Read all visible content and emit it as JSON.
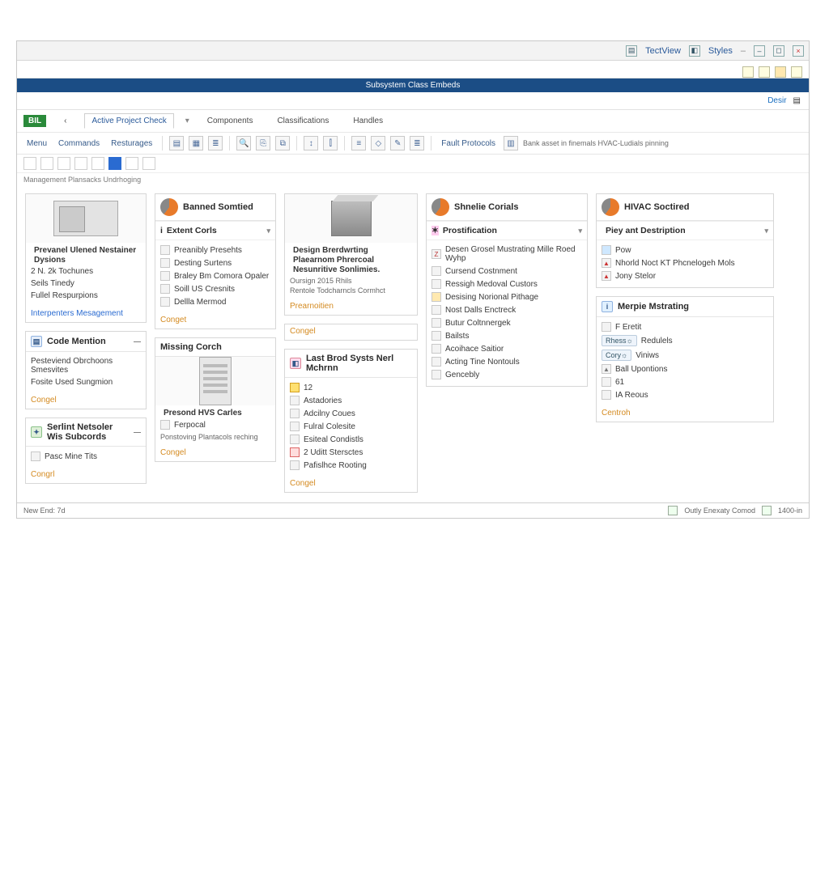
{
  "titlebar": {
    "tectview": "TectView",
    "styles": "Styles",
    "close": "×"
  },
  "subtitle": "Subsystem Class Embeds",
  "breadcrumb": {
    "label": "Desir"
  },
  "menubar": {
    "badge": "BIL",
    "back": "‹",
    "tab_active": "Active Project Check",
    "tab2": "Components",
    "tab3": "Classifications",
    "tab4": "Handles"
  },
  "toolbar": {
    "label_menu": "Menu",
    "label_commands": "Commands",
    "label_resources": "Resturages",
    "fault": "Fault Protocols",
    "hint": "Bank asset in finemals HVAC-Ludials pinning"
  },
  "sectionlabel": "Management Plansacks Undrhoging",
  "col1": {
    "card1": {
      "title": "Prevanel Ulened Nestainer Dysions",
      "r1": "2 N. 2k Tochunes",
      "r2": "Seils Tinedy",
      "r3": "Fullel Respurpions",
      "foot": "Interpenters Mesagement"
    },
    "card2": {
      "title": "Code Mention",
      "r1": "Pesteviend Obrchoons Smesvites",
      "r2": "Fosite Used Sungmion",
      "foot": "Congel"
    },
    "card3": {
      "title": "Serlint Netsoler Wis Subcords",
      "r1": "Pasc Mine Tits",
      "foot": "Congrl"
    }
  },
  "col2": {
    "card1": {
      "title": "Banned Somtied",
      "sub": "Extent Corls",
      "r1": "Preanibly Presehts",
      "r2": "Desting Surtens",
      "r3": "Braley Bm Comora Opaler",
      "r4": "Soill US Cresnits",
      "r5": "Dellla Mermod",
      "foot": "Conget"
    },
    "card2": {
      "title": "Missing Corch",
      "prod": "Presond HVS Carles",
      "sub": "Ferpocal",
      "desc": "Ponstoving Plantacols reching",
      "foot": "Congel"
    }
  },
  "col3": {
    "card1": {
      "title": "Design Brerdwrting Plaearnom Phrercoal Nesunritive Sonlimies.",
      "sub1": "Oursign 2015 Rhils",
      "sub2": "Rentole Todcharncls Cormhct",
      "foot": "Prearnoitien"
    },
    "card2": {
      "foot": "Congel"
    },
    "card3": {
      "title": "Last Brod Systs Nerl Mchrnn",
      "val": "12",
      "r1": "Astadories",
      "r2": "Adcilny Coues",
      "r3": "Fulral Colesite",
      "r4": "Esiteal Condistls",
      "r5": "2 Uditt Stersctes",
      "r6": "Pafislhce Rooting",
      "foot": "Congel"
    }
  },
  "col4": {
    "card1": {
      "title": "Shnelie Corials",
      "sub": "Prostification",
      "r1": "Desen Grosel Mustrating Mille Roed Wyhp",
      "r2": "Cursend Costnment",
      "r3": "Ressigh Medoval Custors",
      "r4": "Desising Norional Pithage",
      "r5": "Nost Dalls Enctreck",
      "r6": "Butur Coltnnergek",
      "r7": "Bailsts",
      "r8": "Acoihace Saitior",
      "r9": "Acting Tine Nontouls",
      "r10": "Gencebly"
    }
  },
  "col5": {
    "card1": {
      "title": "HIVAC Soctired",
      "sub": "Piey ant Destription",
      "r1": "Pow",
      "r2": "Nhorld Noct KT Phcnelogeh Mols",
      "r3": "Jony Stelor"
    },
    "card2": {
      "title": "Merpie Mstrating",
      "r1": "F Eretit",
      "p1": "Redulels",
      "p2": "Viniws",
      "r2": "Ball Upontions",
      "r3": "61",
      "r4": "IA Reous",
      "foot": "Centroh"
    }
  },
  "statusbar": {
    "left": "New End: 7d",
    "right": "Outly Enexaty Comod",
    "zoom": "1400-in"
  }
}
